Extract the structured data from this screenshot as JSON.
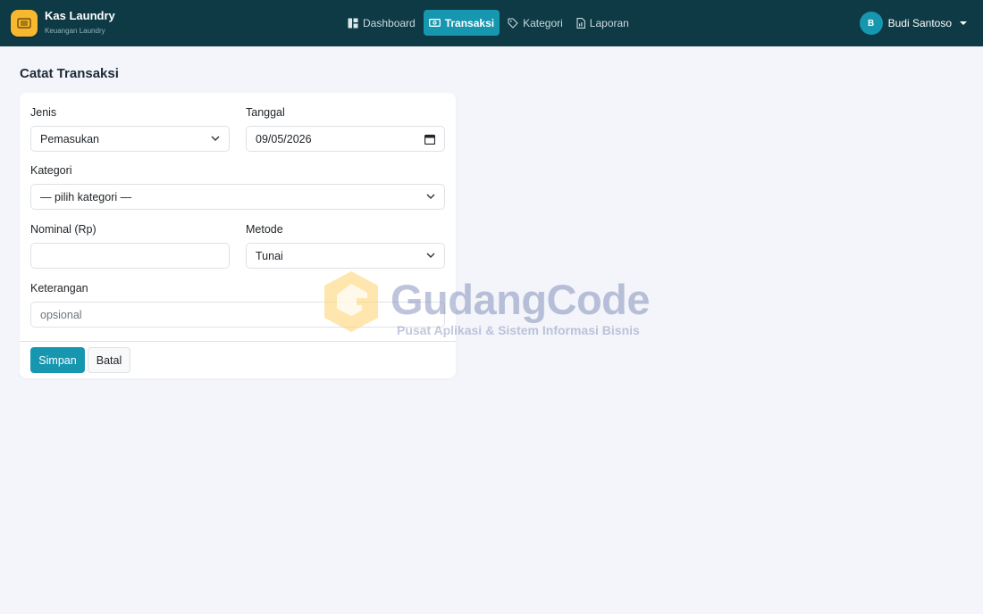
{
  "brand": {
    "title": "Kas Laundry",
    "subtitle": "Keuangan Laundry"
  },
  "nav": [
    {
      "label": "Dashboard",
      "icon": "dashboard-icon",
      "active": false
    },
    {
      "label": "Transaksi",
      "icon": "wallet-icon",
      "active": true
    },
    {
      "label": "Kategori",
      "icon": "tag-icon",
      "active": false
    },
    {
      "label": "Laporan",
      "icon": "report-icon",
      "active": false
    }
  ],
  "user": {
    "initial": "B",
    "name": "Budi Santoso"
  },
  "page": {
    "title": "Catat Transaksi"
  },
  "form": {
    "jenis_label": "Jenis",
    "jenis_value": "Pemasukan",
    "tanggal_label": "Tanggal",
    "tanggal_value": "09/05/2026",
    "kategori_label": "Kategori",
    "kategori_value": "— pilih kategori —",
    "nominal_label": "Nominal (Rp)",
    "nominal_value": "",
    "metode_label": "Metode",
    "metode_value": "Tunai",
    "keterangan_label": "Keterangan",
    "keterangan_placeholder": "opsional",
    "save_label": "Simpan",
    "cancel_label": "Batal"
  },
  "watermark": {
    "title": "GudangCode",
    "subtitle": "Pusat Aplikasi & Sistem Informasi Bisnis"
  },
  "colors": {
    "navbar": "#0e3a45",
    "accent": "#1796b0",
    "logo": "#f5b82e",
    "background": "#f3f5fa"
  }
}
